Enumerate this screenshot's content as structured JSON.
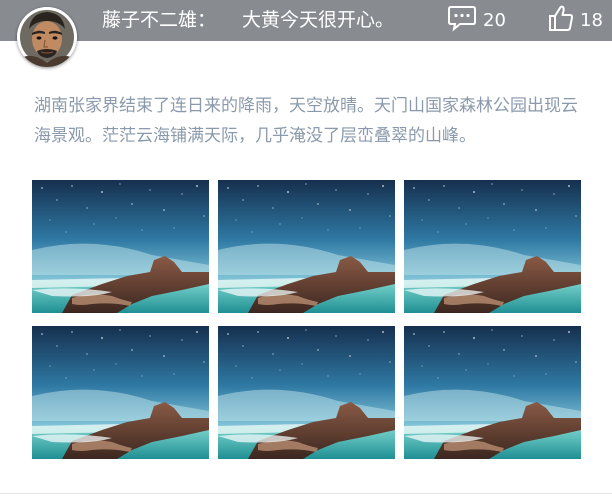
{
  "header": {
    "username": "藤子不二雄：",
    "message": "大黄今天很开心。",
    "comment_count": "20",
    "like_count": "18",
    "comment_icon": "comment-icon",
    "like_icon": "thumbs-up-icon"
  },
  "post": {
    "text": "湖南张家界结束了连日来的降雨，天空放晴。天门山国家森林公园出现云海景观。茫茫云海铺满天际，几乎淹没了层峦叠翠的山峰。"
  },
  "photos": {
    "count": 6,
    "subject": "starry-sky-seascape"
  },
  "colors": {
    "header_bg": "#888c91",
    "text_gray": "#8a99ab",
    "white": "#ffffff"
  }
}
